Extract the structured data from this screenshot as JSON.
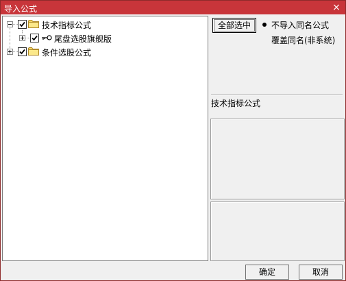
{
  "window": {
    "title": "导入公式",
    "close_glyph": "×"
  },
  "tree": {
    "nodes": [
      {
        "label": "技术指标公式",
        "checked": true,
        "expanded": true,
        "icon": "folder-icon"
      },
      {
        "label": "尾盘选股旗舰版",
        "checked": true,
        "expanded": false,
        "icon": "key-icon"
      },
      {
        "label": "条件选股公式",
        "checked": true,
        "expanded": false,
        "icon": "folder-icon"
      }
    ]
  },
  "controls": {
    "select_all_label": "全部选中",
    "radio_options": [
      {
        "label": "不导入同名公式",
        "selected": true
      },
      {
        "label": "覆盖同名(非系统)",
        "selected": false
      }
    ]
  },
  "info": {
    "selected_name": "技术指标公式"
  },
  "footer": {
    "ok_label": "确定",
    "cancel_label": "取消"
  },
  "colors": {
    "titlebar": "#c8353a",
    "folder": "#f5d96b"
  }
}
